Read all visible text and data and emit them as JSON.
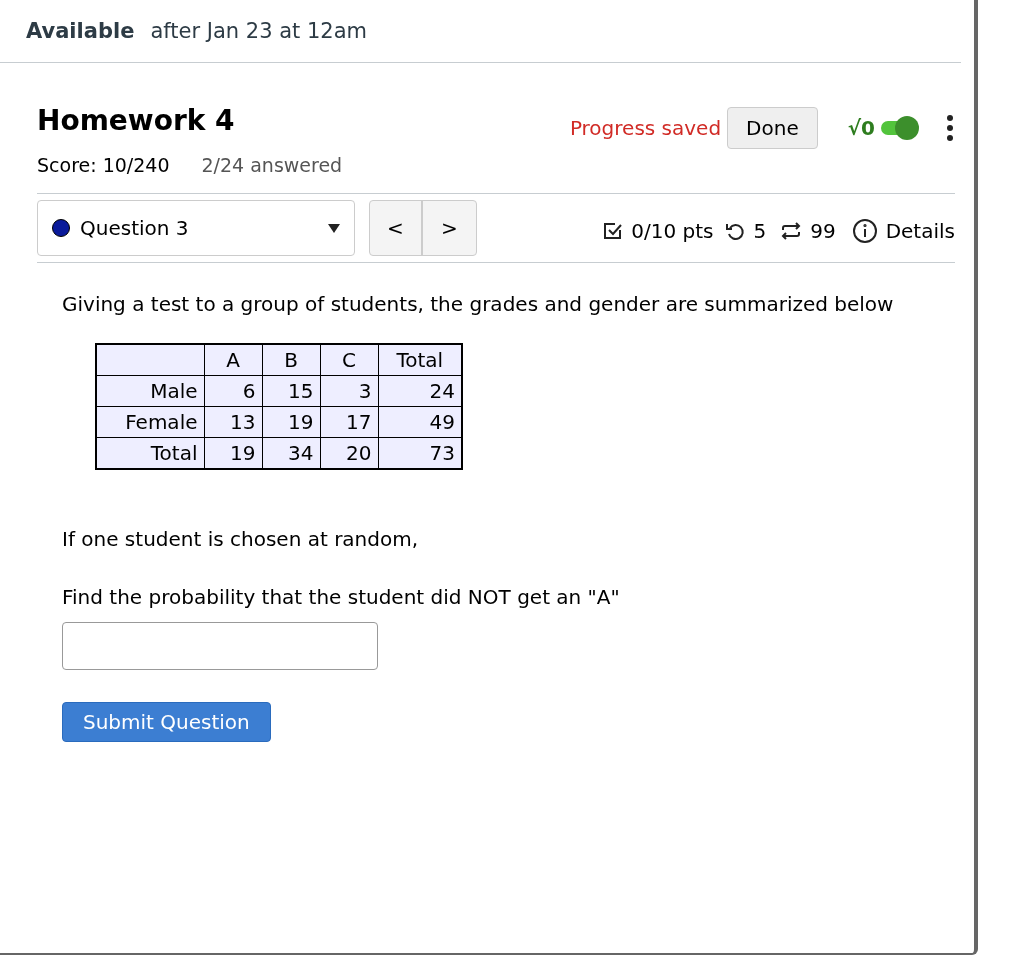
{
  "availability": {
    "label": "Available",
    "value": "after Jan 23 at 12am"
  },
  "assignment": {
    "title": "Homework 4",
    "score": "Score: 10/240",
    "answered": "2/24 answered",
    "progress": "Progress saved",
    "done_button": "Done",
    "math_toggle": {
      "label": "√0",
      "on": true
    }
  },
  "question_nav": {
    "selector": {
      "label": "Question 3",
      "color": "#0a1a9a"
    },
    "prev": "<",
    "next": ">"
  },
  "question_meta": {
    "points": "0/10 pts",
    "retries": "5",
    "attempts": "99",
    "details": "Details"
  },
  "question": {
    "intro": "Giving a test to a group of students, the grades and gender are summarized below",
    "table": {
      "columns": [
        "",
        "A",
        "B",
        "C",
        "Total"
      ],
      "rows": [
        [
          "Male",
          "6",
          "15",
          "3",
          "24"
        ],
        [
          "Female",
          "13",
          "19",
          "17",
          "49"
        ],
        [
          "Total",
          "19",
          "34",
          "20",
          "73"
        ]
      ]
    },
    "condition": "If one student is chosen at random,",
    "prompt": "Find the probability that the student did NOT get an \"A\"",
    "submit": "Submit Question"
  }
}
